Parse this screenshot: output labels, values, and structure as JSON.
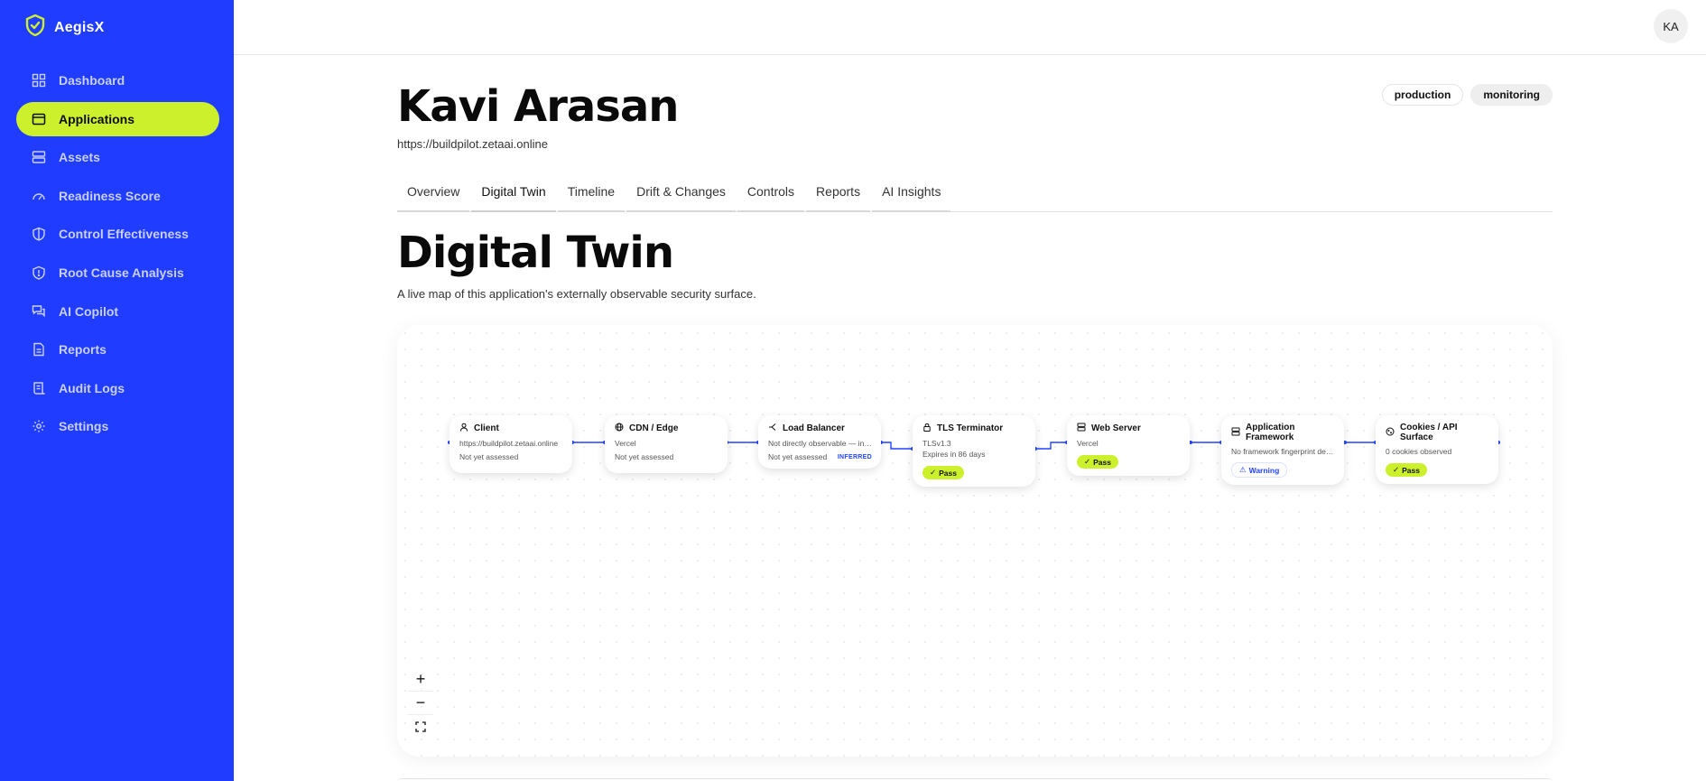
{
  "app": {
    "name": "AegisX"
  },
  "sidebar": {
    "items": [
      {
        "label": "Dashboard",
        "icon": "grid-icon"
      },
      {
        "label": "Applications",
        "icon": "window-icon",
        "active": true
      },
      {
        "label": "Assets",
        "icon": "server-icon"
      },
      {
        "label": "Readiness Score",
        "icon": "gauge-icon"
      },
      {
        "label": "Control Effectiveness",
        "icon": "shield-icon"
      },
      {
        "label": "Root Cause Analysis",
        "icon": "shield-alert-icon"
      },
      {
        "label": "AI Copilot",
        "icon": "chat-icon"
      },
      {
        "label": "Reports",
        "icon": "document-icon"
      },
      {
        "label": "Audit Logs",
        "icon": "scroll-icon"
      },
      {
        "label": "Settings",
        "icon": "gear-icon"
      }
    ]
  },
  "topbar": {
    "avatar_initials": "KA"
  },
  "header": {
    "title": "Kavi Arasan",
    "url": "https://buildpilot.zetaai.online",
    "tags": [
      "production",
      "monitoring"
    ]
  },
  "tabs": [
    "Overview",
    "Digital Twin",
    "Timeline",
    "Drift & Changes",
    "Controls",
    "Reports",
    "AI Insights"
  ],
  "section": {
    "title": "Digital Twin",
    "subtitle": "A live map of this application's externally observable security surface."
  },
  "nodes": [
    {
      "title": "Client",
      "icon": "user-icon",
      "line1": "https://buildpilot.zetaai.online",
      "line2": "Not yet assessed"
    },
    {
      "title": "CDN / Edge",
      "icon": "globe-icon",
      "line1": "Vercel",
      "line2": "Not yet assessed"
    },
    {
      "title": "Load Balancer",
      "icon": "split-icon",
      "line1": "Not directly observable — inferred",
      "line2": "Not yet assessed",
      "badge": "INFERRED"
    },
    {
      "title": "TLS Terminator",
      "icon": "lock-icon",
      "line1": "TLSv1.3",
      "line2": "Expires in 86 days",
      "status": "Pass"
    },
    {
      "title": "Web Server",
      "icon": "server-icon",
      "line1": "Vercel",
      "status": "Pass"
    },
    {
      "title": "Application Framework",
      "icon": "layers-icon",
      "line1": "No framework fingerprint detected",
      "status": "Warning"
    },
    {
      "title": "Cookies / API Surface",
      "icon": "cookie-icon",
      "line1": "0 cookies observed",
      "status": "Pass"
    }
  ],
  "zoom_controls": {
    "zoom_in": "+",
    "zoom_out": "−",
    "fit": "⛶"
  },
  "colors": {
    "sidebar": "#1f3cff",
    "accent": "#cdf02d",
    "edge": "#2244ff"
  }
}
